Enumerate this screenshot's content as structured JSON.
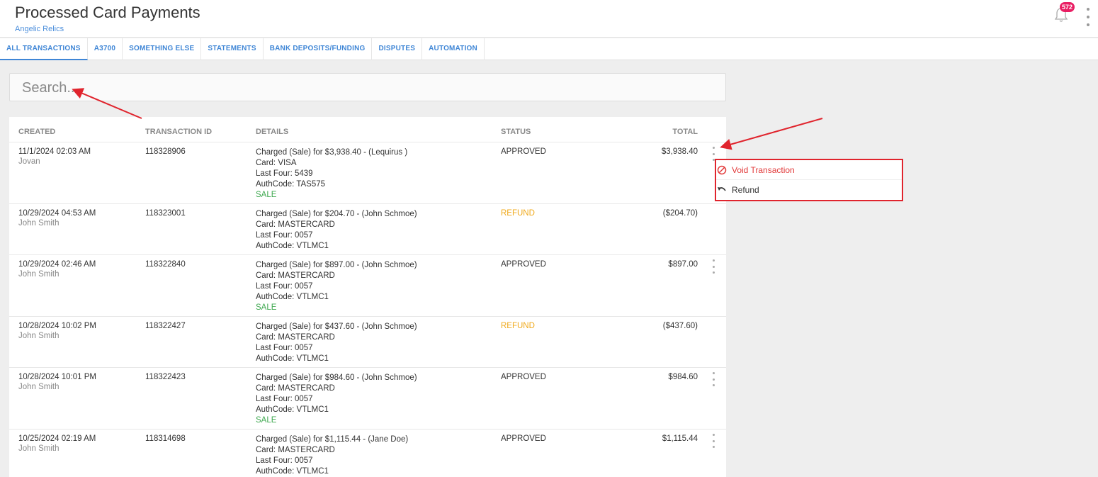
{
  "header": {
    "title": "Processed Card Payments",
    "subtitle": "Angelic Relics",
    "notification_count": "572",
    "bell_icon": "bell-icon",
    "menu_icon": "kebab-icon"
  },
  "tabs": [
    {
      "label": "ALL TRANSACTIONS",
      "active": true
    },
    {
      "label": "A3700"
    },
    {
      "label": "SOMETHING ELSE"
    },
    {
      "label": "STATEMENTS"
    },
    {
      "label": "BANK DEPOSITS/FUNDING"
    },
    {
      "label": "DISPUTES"
    },
    {
      "label": "AUTOMATION"
    }
  ],
  "search": {
    "placeholder": "Search..."
  },
  "table": {
    "columns": {
      "created": "CREATED",
      "transaction_id": "TRANSACTION ID",
      "details": "DETAILS",
      "status": "STATUS",
      "total": "TOTAL"
    },
    "rows": [
      {
        "created": "11/1/2024 02:03 AM",
        "user": "Jovan",
        "transaction_id": "118328906",
        "details": [
          "Charged (Sale) for $3,938.40 - (Lequirus )",
          "Card: VISA",
          "Last Four: 5439",
          "AuthCode: TAS575"
        ],
        "type": "SALE",
        "status": "APPROVED",
        "total": "$3,938.40",
        "has_menu": true
      },
      {
        "created": "10/29/2024 04:53 AM",
        "user": "John Smith",
        "transaction_id": "118323001",
        "details": [
          "Charged (Sale) for $204.70 - (John Schmoe)",
          "Card: MASTERCARD",
          "Last Four: 0057",
          "AuthCode: VTLMC1"
        ],
        "type": "",
        "status": "REFUND",
        "total": "($204.70)",
        "has_menu": false
      },
      {
        "created": "10/29/2024 02:46 AM",
        "user": "John Smith",
        "transaction_id": "118322840",
        "details": [
          "Charged (Sale) for $897.00 - (John Schmoe)",
          "Card: MASTERCARD",
          "Last Four: 0057",
          "AuthCode: VTLMC1"
        ],
        "type": "SALE",
        "status": "APPROVED",
        "total": "$897.00",
        "has_menu": true
      },
      {
        "created": "10/28/2024 10:02 PM",
        "user": "John Smith",
        "transaction_id": "118322427",
        "details": [
          "Charged (Sale) for $437.60 - (John Schmoe)",
          "Card: MASTERCARD",
          "Last Four: 0057",
          "AuthCode: VTLMC1"
        ],
        "type": "",
        "status": "REFUND",
        "total": "($437.60)",
        "has_menu": false
      },
      {
        "created": "10/28/2024 10:01 PM",
        "user": "John Smith",
        "transaction_id": "118322423",
        "details": [
          "Charged (Sale) for $984.60 - (John Schmoe)",
          "Card: MASTERCARD",
          "Last Four: 0057",
          "AuthCode: VTLMC1"
        ],
        "type": "SALE",
        "status": "APPROVED",
        "total": "$984.60",
        "has_menu": true
      },
      {
        "created": "10/25/2024 02:19 AM",
        "user": "John Smith",
        "transaction_id": "118314698",
        "details": [
          "Charged (Sale) for $1,115.44 - (Jane Doe)",
          "Card: MASTERCARD",
          "Last Four: 0057",
          "AuthCode: VTLMC1"
        ],
        "type": "",
        "status": "APPROVED",
        "total": "$1,115.44",
        "has_menu": true
      }
    ]
  },
  "context_menu": {
    "items": [
      {
        "label": "Void Transaction",
        "icon": "ban-icon"
      },
      {
        "label": "Refund",
        "icon": "undo-icon"
      }
    ]
  },
  "colors": {
    "accent": "#3f86d6",
    "approved": "#333333",
    "refund": "#f0a91a",
    "sale": "#3ea84f",
    "badge": "#e91e63",
    "annotation": "#e0242d"
  }
}
